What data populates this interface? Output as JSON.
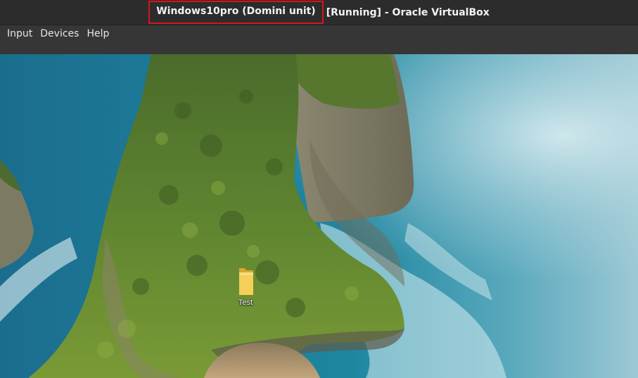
{
  "window": {
    "title_highlighted": "Windows10pro (Domini unit)",
    "title_rest": "[Running] - Oracle VirtualBox"
  },
  "menu": {
    "items": [
      {
        "label": "Input"
      },
      {
        "label": "Devices"
      },
      {
        "label": "Help"
      }
    ]
  },
  "desktop": {
    "wallpaper": "cliff-ocean-wallpaper",
    "icons": [
      {
        "label": "Test",
        "icon": "folder-icon"
      }
    ]
  },
  "colors": {
    "highlight_border": "#d9141b",
    "titlebar": "#2c2c2c",
    "menubar": "#363636"
  }
}
